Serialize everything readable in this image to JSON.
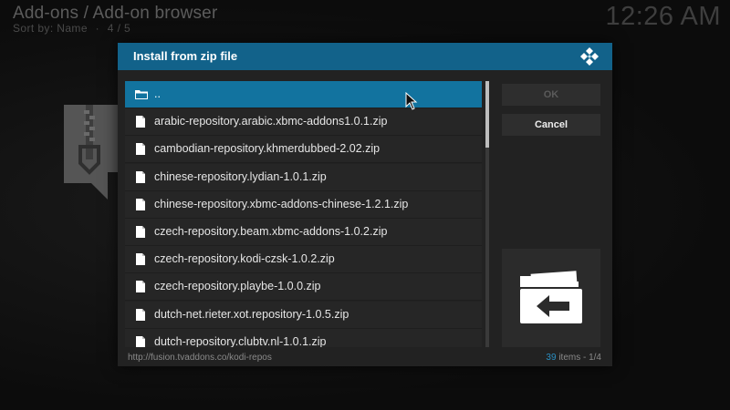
{
  "background": {
    "title": "Add-ons / Add-on browser",
    "sort": "Sort by: Name",
    "page_sep": "·",
    "page": "4 / 5",
    "clock": "12:26 AM"
  },
  "dialog": {
    "title": "Install from zip file",
    "files": [
      {
        "name": "..",
        "icon": "folder-open-icon",
        "selected": true
      },
      {
        "name": "arabic-repository.arabic.xbmc-addons1.0.1.zip",
        "icon": "file-icon"
      },
      {
        "name": "cambodian-repository.khmerdubbed-2.02.zip",
        "icon": "file-icon"
      },
      {
        "name": "chinese-repository.lydian-1.0.1.zip",
        "icon": "file-icon"
      },
      {
        "name": "chinese-repository.xbmc-addons-chinese-1.2.1.zip",
        "icon": "file-icon"
      },
      {
        "name": "czech-repository.beam.xbmc-addons-1.0.2.zip",
        "icon": "file-icon"
      },
      {
        "name": "czech-repository.kodi-czsk-1.0.2.zip",
        "icon": "file-icon"
      },
      {
        "name": "czech-repository.playbe-1.0.0.zip",
        "icon": "file-icon"
      },
      {
        "name": "dutch-net.rieter.xot.repository-1.0.5.zip",
        "icon": "file-icon"
      },
      {
        "name": "dutch-repository.clubtv.nl-1.0.1.zip",
        "icon": "file-icon"
      }
    ],
    "ok_label": "OK",
    "cancel_label": "Cancel",
    "footer_path": "http://fusion.tvaddons.co/kodi-repos",
    "item_count": "39",
    "items_label": "items - 1/4"
  },
  "colors": {
    "accent": "#12739f",
    "header": "#12628a"
  }
}
